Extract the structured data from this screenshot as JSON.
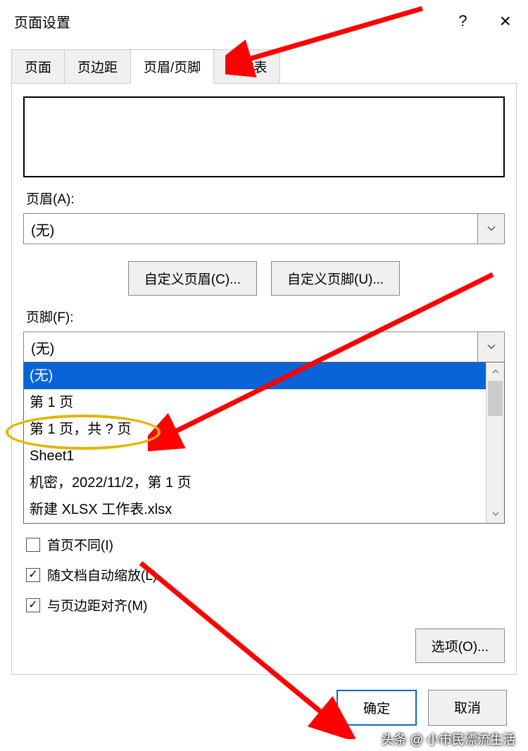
{
  "title": "页面设置",
  "titlebar": {
    "help": "?",
    "close": "×"
  },
  "tabs": [
    "页面",
    "页边距",
    "页眉/页脚",
    "工作表"
  ],
  "header": {
    "label": "页眉(A):",
    "value": "(无)"
  },
  "custom_buttons": {
    "header": "自定义页眉(C)...",
    "footer": "自定义页脚(U)..."
  },
  "footer": {
    "label": "页脚(F):",
    "value": "(无)",
    "options": [
      "(无)",
      "第 1 页",
      "第 1 页，共 ? 页",
      "Sheet1",
      " 机密，2022/11/2，第 1 页",
      "新建 XLSX 工作表.xlsx"
    ]
  },
  "checkboxes": {
    "different_first": {
      "label": "首页不同(I)",
      "checked": false
    },
    "scale_with_doc": {
      "label": "随文档自动缩放(L)",
      "checked": true
    },
    "align_margins": {
      "label": "与页边距对齐(M)",
      "checked": true
    }
  },
  "options_button": "选项(O)...",
  "dialog_buttons": {
    "ok": "确定",
    "cancel": "取消"
  },
  "watermark": "头条 @ 小市民漂流生活"
}
